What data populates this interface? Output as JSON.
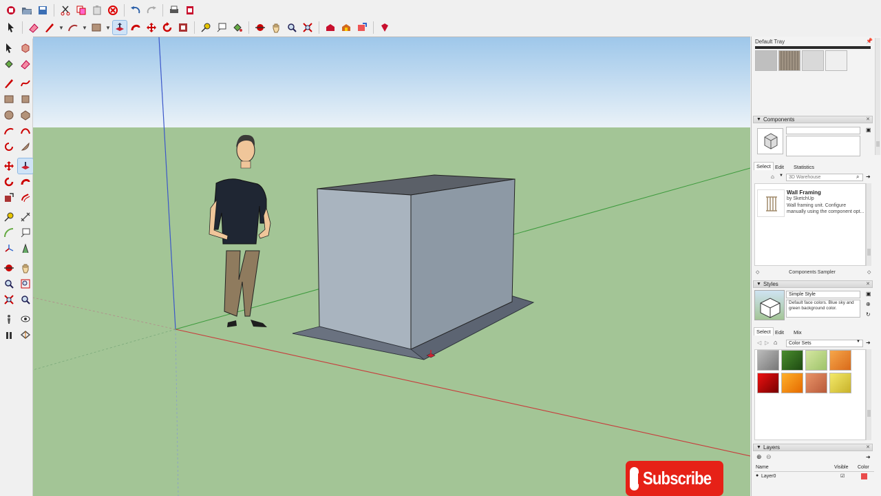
{
  "toolbar_top": {
    "icons": [
      "new-file-icon",
      "open-folder-icon",
      "save-icon",
      "cut-icon",
      "copy-icon",
      "paste-icon",
      "delete-icon",
      "undo-icon",
      "redo-icon",
      "print-icon",
      "model-info-icon"
    ]
  },
  "toolbar_second": {
    "icons": [
      "select-arrow-icon",
      "eraser-icon",
      "pencil-line-icon",
      "arc-icon",
      "rectangle-icon",
      "push-pull-icon",
      "follow-me-icon",
      "move-icon",
      "rotate-icon",
      "offset-icon",
      "tape-measure-icon",
      "text-label-icon",
      "paint-bucket-icon",
      "orbit-icon",
      "pan-icon",
      "zoom-icon",
      "zoom-extents-icon",
      "warehouse-icon",
      "extension-warehouse-icon",
      "share-model-icon",
      "ruby-icon"
    ]
  },
  "tray": {
    "title": "Default Tray",
    "components": {
      "header": "Components",
      "tabs": [
        "Select",
        "Edit",
        "Statistics"
      ],
      "search_placeholder": "3D Warehouse",
      "item_name": "Wall Framing",
      "item_author": "by SketchUp",
      "item_desc": "Wall framing unit.  Configure manually using the component opt...",
      "collection": "Components Sampler"
    },
    "styles": {
      "header": "Styles",
      "style_name": "Simple Style",
      "style_desc": "Default face colors. Blue sky and green background color.",
      "tabs": [
        "Select",
        "Edit",
        "Mix"
      ],
      "collection": "Color Sets"
    },
    "layers": {
      "header": "Layers",
      "columns": [
        "Name",
        "Visible",
        "Color"
      ],
      "rows": [
        {
          "name": "Layer0",
          "visible": true,
          "color": "#e94b4b"
        }
      ]
    }
  },
  "subscribe": {
    "label": "Subscribe"
  },
  "colors": {
    "sky_top": "#9ec7ea",
    "sky_bottom": "#e8f1f8",
    "ground": "#a3c596",
    "box_front": "#a9b4bf",
    "box_side": "#8b97a3",
    "box_top": "#596068"
  }
}
